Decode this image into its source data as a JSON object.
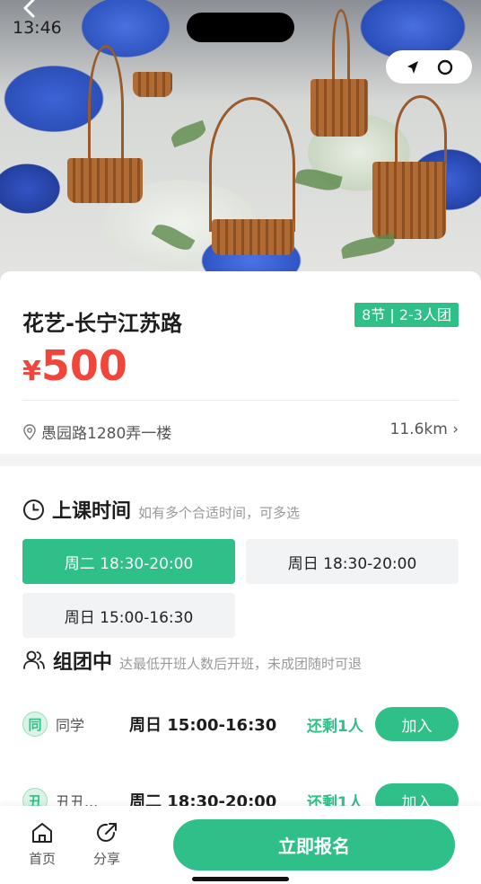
{
  "status_bar": {
    "time": "13:46"
  },
  "hero": {
    "alt_icon": "back-icon"
  },
  "course": {
    "title": "花艺-长宁江苏路",
    "tag": "8节 | 2-3人团",
    "currency": "¥",
    "price": "500",
    "address": "愚园路1280弄一楼",
    "distance": "11.6km ›"
  },
  "schedule": {
    "title": "上课时间",
    "subtitle": "如有多个合适时间，可多选",
    "slots": [
      {
        "label": "周二 18:30-20:00",
        "selected": true
      },
      {
        "label": "周日 18:30-20:00",
        "selected": false
      },
      {
        "label": "周日 15:00-16:30",
        "selected": false
      }
    ]
  },
  "groups": {
    "title": "组团中",
    "subtitle": "达最低开班人数后开班，未成团随时可退",
    "rows": [
      {
        "avatar": "同",
        "name": "同学",
        "time": "周日 15:00-16:30",
        "left": "还剩1人",
        "button": "加入"
      },
      {
        "avatar": "丑",
        "name": "丑丑...",
        "time": "周二 18:30-20:00",
        "left": "还剩1人",
        "button": "加入"
      }
    ]
  },
  "bottom_bar": {
    "home": "首页",
    "share": "分享",
    "signup": "立即报名"
  },
  "colors": {
    "accent": "#2fbf88",
    "price": "#f1463b"
  }
}
